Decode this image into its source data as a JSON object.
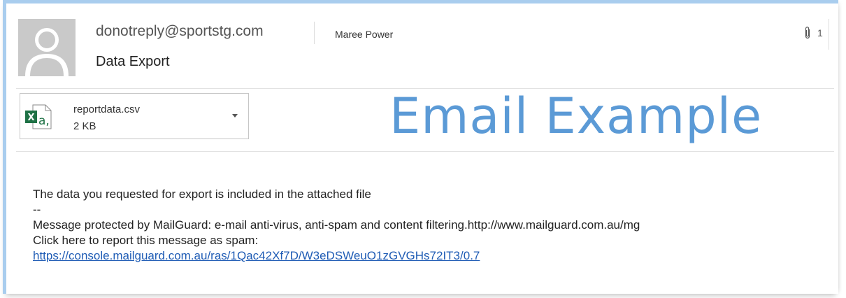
{
  "header": {
    "sender": "donotreply@sportstg.com",
    "recipient": "Maree Power",
    "attachment_count": "1",
    "subject": "Data Export"
  },
  "attachment": {
    "filename": "reportdata.csv",
    "size": "2 KB",
    "icon": "excel-file-icon"
  },
  "watermark": "Email Example",
  "body": {
    "line1": "The data you requested for export is included in the attached file",
    "separator": "--",
    "line2": "Message  protected by MailGuard: e-mail anti-virus, anti-spam and content filtering.http://www.mailguard.com.au/mg",
    "line3": "Click here to report this message as spam:",
    "link": "https://console.mailguard.com.au/ras/1Qac42Xf7D/W3eDSWeuO1zGVGHs72IT3/0.7"
  },
  "colors": {
    "frame_border": "#a9cdee",
    "watermark": "#5b9ad6",
    "link": "#1f5cb5",
    "excel_green": "#1e7145"
  }
}
